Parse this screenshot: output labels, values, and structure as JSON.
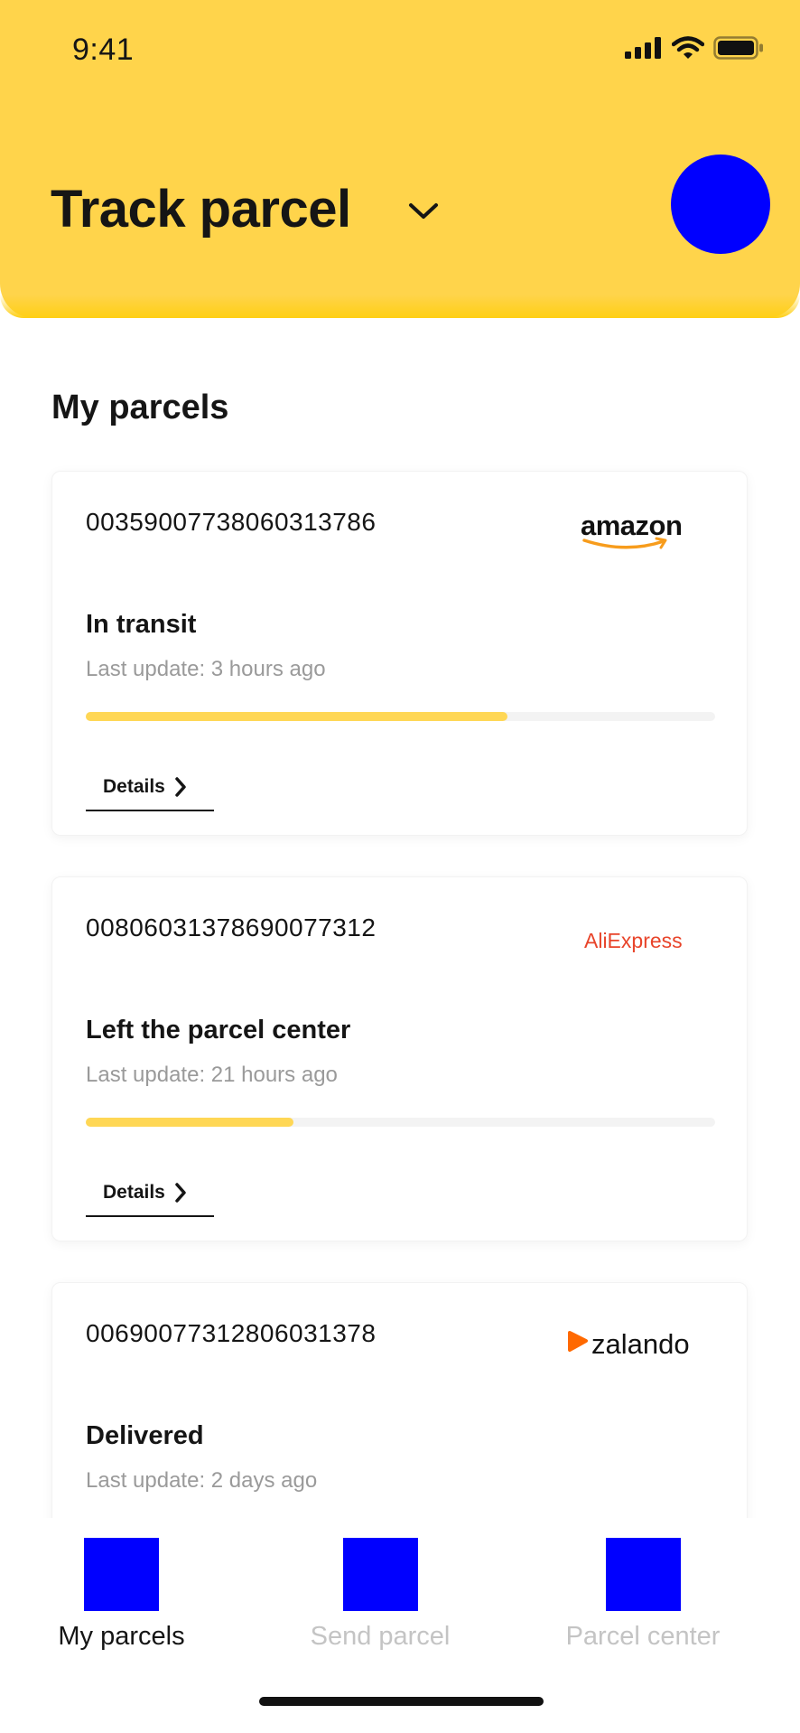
{
  "status_bar": {
    "time": "9:41",
    "signal_icon": "cellular-signal-icon",
    "wifi_icon": "wifi-icon",
    "battery_icon": "battery-icon"
  },
  "header": {
    "title": "Track parcel",
    "chevron_icon": "chevron-down-icon",
    "avatar_color": "#0000ff",
    "background_color": "#ffd44b"
  },
  "section_title": "My parcels",
  "parcels": [
    {
      "tracking_number": "00359007738060313786",
      "brand": "amazon",
      "status": "In transit",
      "last_update": "Last update: 3 hours ago",
      "progress": 0.67,
      "details_label": "Details"
    },
    {
      "tracking_number": "00806031378690077312",
      "brand": "AliExpress",
      "status": "Left the parcel center",
      "last_update": "Last update: 21 hours ago",
      "progress": 0.33,
      "details_label": "Details"
    },
    {
      "tracking_number": "00690077312806031378",
      "brand": "zalando",
      "status": "Delivered",
      "last_update": "Last update: 2 days ago"
    }
  ],
  "tabs": [
    {
      "label": "My parcels",
      "active": true,
      "color": "#151515"
    },
    {
      "label": "Send parcel",
      "active": false,
      "color": "#c4c4c4"
    },
    {
      "label": "Parcel center",
      "active": false,
      "color": "#c4c4c4"
    }
  ],
  "colors": {
    "accent": "#ffd44b",
    "progress": "#ffd755",
    "amazon_smile": "#f79c1c",
    "aliexpress": "#e8442a",
    "zalando_orange": "#ff6900",
    "tab_icon": "#0000ff"
  }
}
